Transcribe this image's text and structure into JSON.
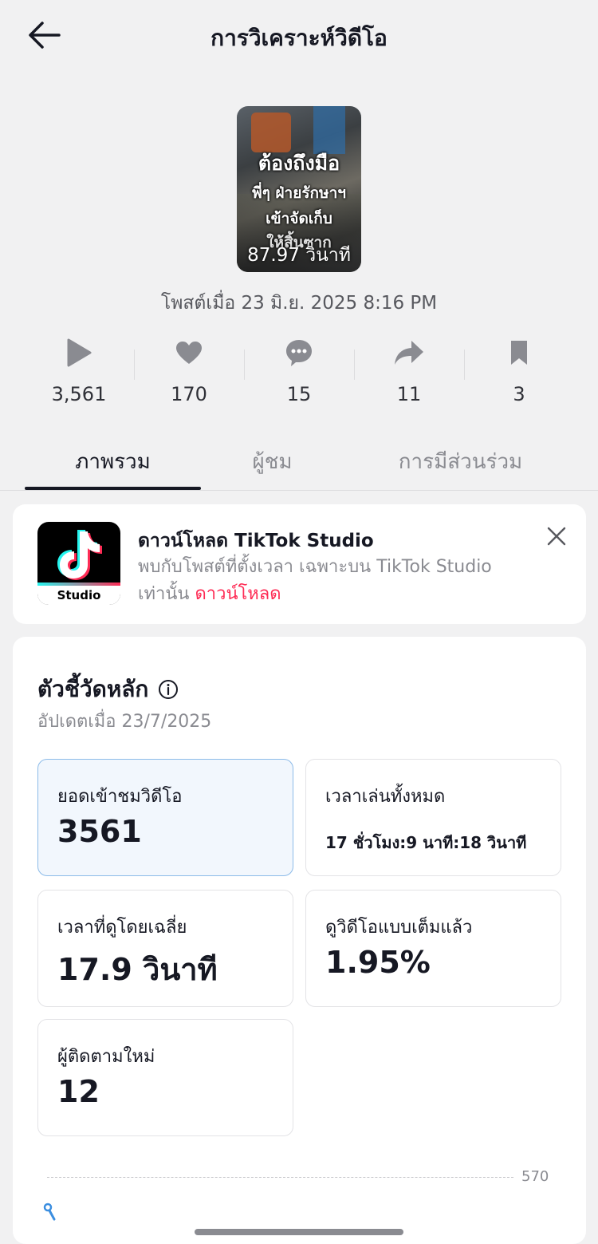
{
  "header": {
    "title": "การวิเคราะห์วิดีโอ"
  },
  "video": {
    "thumbnail_lines": [
      "ต้องถึงมือ",
      "พี่ๆ ฝ่ายรักษาฯ",
      "เข้าจัดเก็บ",
      "ให้สิ้นซาก"
    ],
    "duration": "87.97 วินาที",
    "posted": "โพสต์เมื่อ 23 มิ.ย. 2025 8:16 PM"
  },
  "stats": [
    {
      "icon": "play-icon",
      "value": "3,561"
    },
    {
      "icon": "heart-icon",
      "value": "170"
    },
    {
      "icon": "comment-icon",
      "value": "15"
    },
    {
      "icon": "share-icon",
      "value": "11"
    },
    {
      "icon": "bookmark-icon",
      "value": "3"
    }
  ],
  "tabs": [
    {
      "label": "ภาพรวม",
      "active": true
    },
    {
      "label": "ผู้ชม",
      "active": false
    },
    {
      "label": "การมีส่วนร่วม",
      "active": false
    }
  ],
  "promo": {
    "logo_text": "Studio",
    "title": "ดาวน์โหลด TikTok Studio",
    "description": "พบกับโพสต์ที่ตั้งเวลา เฉพาะบน TikTok Studio เท่านั้น",
    "link": "ดาวน์โหลด"
  },
  "metrics": {
    "title": "ตัวชี้วัดหลัก",
    "updated": "อัปเดตเมื่อ 23/7/2025",
    "items": [
      {
        "label": "ยอดเข้าชมวิดีโอ",
        "value": "3561"
      },
      {
        "label": "เวลาเล่นทั้งหมด",
        "value": "17 ชั่วโมง:9 นาที:18 วินาที"
      },
      {
        "label": "เวลาที่ดูโดยเฉลี่ย",
        "value": "17.9 วินาที"
      },
      {
        "label": "ดูวิดีโอแบบเต็มแล้ว",
        "value": "1.95%"
      },
      {
        "label": "ผู้ติดตามใหม่",
        "value": "12"
      }
    ]
  },
  "chart": {
    "max_tick": "570"
  },
  "colors": {
    "accent_pink": "#fe2c55",
    "selected_bg": "#f2f7fd",
    "selected_border": "#8cbbe9",
    "chart_point": "#3b8ee0"
  }
}
